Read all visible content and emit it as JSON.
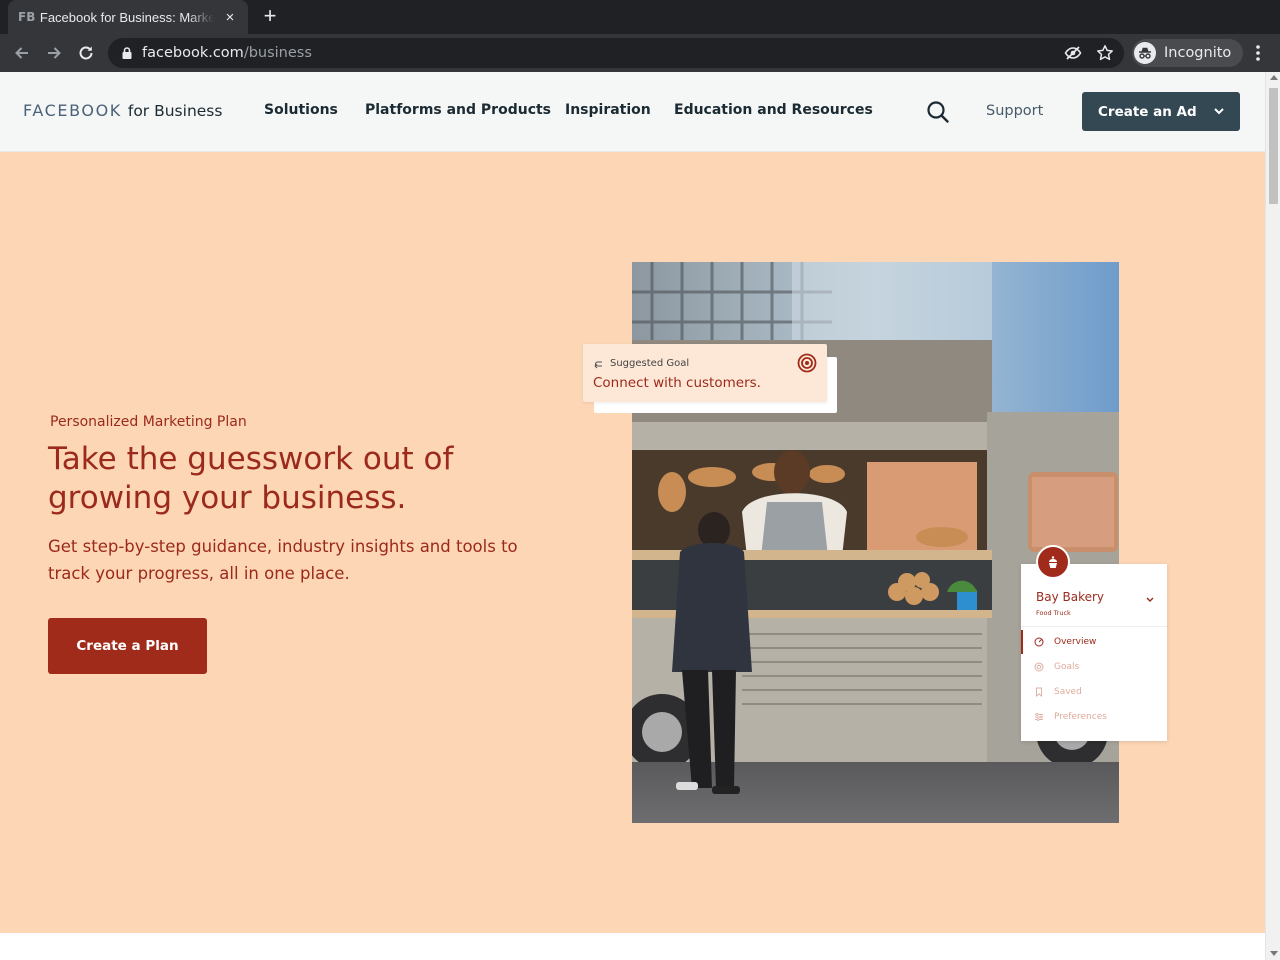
{
  "browser": {
    "tab": {
      "favicon": "FB",
      "title": "Facebook for Business: Marketing on Facebook",
      "close": "×"
    },
    "new_tab": "+",
    "url": {
      "host": "facebook.com",
      "path": "/business"
    },
    "profile_label": "Incognito",
    "icons": [
      "back-arrow-icon",
      "forward-arrow-icon",
      "reload-icon",
      "lock-icon",
      "eye-off-icon",
      "star-icon",
      "incognito-icon",
      "kebab-menu-icon"
    ]
  },
  "header": {
    "logo": {
      "brand": "FACEBOOK",
      "suffix": "for Business"
    },
    "nav": [
      "Solutions",
      "Platforms and Products",
      "Inspiration",
      "Education and Resources"
    ],
    "support": "Support",
    "cta": "Create an Ad"
  },
  "hero": {
    "eyebrow": "Personalized Marketing Plan",
    "headline": "Take the guesswork out of growing your business.",
    "subhead": "Get step-by-step guidance, industry insights and tools to track your progress, all in one place.",
    "cta": "Create a Plan",
    "goal_card": {
      "eyebrow": "Suggested Goal",
      "text": "Connect with customers."
    },
    "business_panel": {
      "name": "Bay Bakery",
      "subtitle": "Food Truck",
      "menu": [
        {
          "label": "Overview",
          "active": true
        },
        {
          "label": "Goals",
          "active": false
        },
        {
          "label": "Saved",
          "active": false
        },
        {
          "label": "Preferences",
          "active": false
        }
      ]
    }
  },
  "colors": {
    "accent": "#9b2a1c",
    "hero_bg": "#fcd6b5",
    "header_bg": "#f5f6f6",
    "cta_dark": "#344854"
  }
}
